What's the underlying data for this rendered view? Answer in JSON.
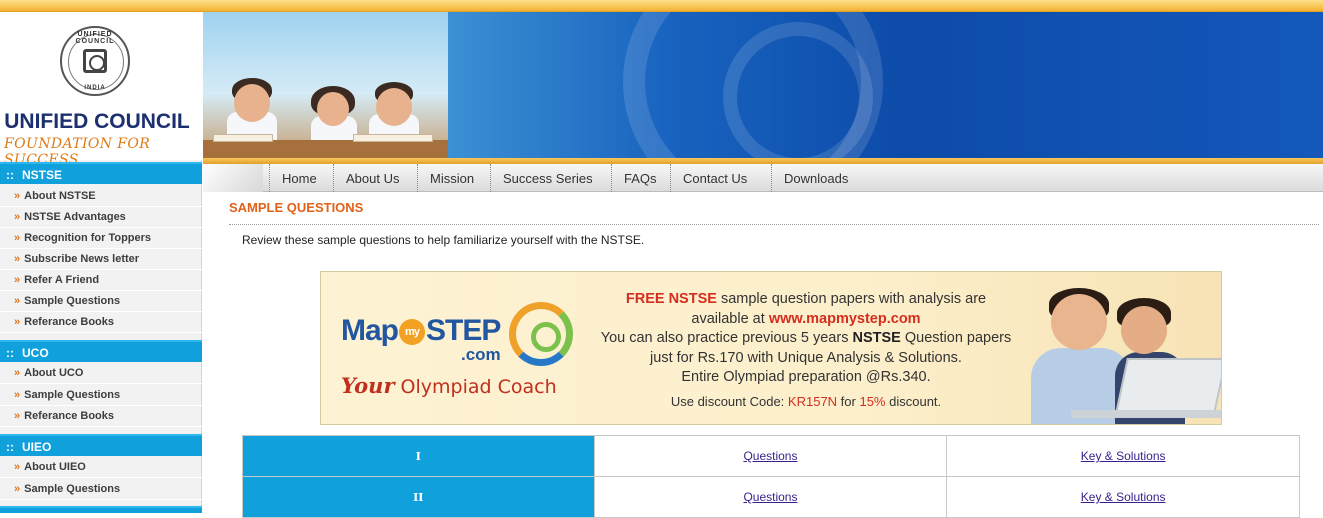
{
  "brand": {
    "seal_top": "UNIFIED COUNCIL",
    "seal_bottom": "INDIA",
    "name": "UNIFIED COUNCIL",
    "tagline": "FOUNDATION FOR SUCCESS"
  },
  "sidebar": {
    "sections": [
      {
        "title": "NSTSE",
        "items": [
          "About NSTSE",
          "NSTSE Advantages",
          "Recognition for Toppers",
          "Subscribe News letter",
          "Refer A Friend",
          "Sample Questions",
          "Referance Books"
        ]
      },
      {
        "title": "UCO",
        "items": [
          "About UCO",
          "Sample Questions",
          "Referance Books"
        ]
      },
      {
        "title": "UIEO",
        "items": [
          "About UIEO",
          "Sample Questions"
        ]
      }
    ],
    "bullet": "»",
    "section_marker": "::"
  },
  "nav": {
    "items": [
      "Home",
      "About Us",
      "Mission",
      "Success Series",
      "FAQs",
      "Contact Us",
      "Downloads"
    ]
  },
  "page": {
    "title": "SAMPLE QUESTIONS",
    "intro": "Review these sample questions to help familiarize yourself with the NSTSE."
  },
  "ad": {
    "logo_map": "Map",
    "logo_my": "my",
    "logo_step": "STEP",
    "logo_com": ".com",
    "coach_your": "Your",
    "coach_rest": " Olympiad Coach",
    "line1_free": "FREE NSTSE",
    "line1_rest": " sample question papers with analysis are",
    "line2_pre": "available at ",
    "line2_url": "www.mapmystep.com",
    "line3_pre": "You can also practice previous 5 years ",
    "line3_bold": "NSTSE",
    "line3_rest": " Question papers",
    "line4": "just for Rs.170 with Unique Analysis & Solutions.",
    "line5": "Entire Olympiad preparation @Rs.340.",
    "discount_pre": "Use discount Code: ",
    "discount_code": "KR157N",
    "discount_mid": " for ",
    "discount_pct": "15%",
    "discount_post": " discount."
  },
  "grades": [
    {
      "label": "I",
      "questions": "Questions",
      "key": "Key & Solutions"
    },
    {
      "label": "II",
      "questions": "Questions",
      "key": "Key & Solutions"
    }
  ]
}
